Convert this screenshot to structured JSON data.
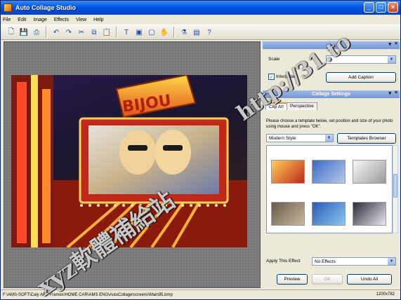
{
  "window": {
    "title": "Auto Collage Studio",
    "controls": {
      "minimize": "_",
      "maximize": "□",
      "close": "×"
    }
  },
  "menu": [
    "File",
    "Edit",
    "Image",
    "Effects",
    "View",
    "Help"
  ],
  "toolbar": {
    "buttons": [
      {
        "name": "new",
        "icon": "new-file-icon",
        "glyph": "🗋"
      },
      {
        "name": "save",
        "icon": "save-icon",
        "glyph": "💾"
      },
      {
        "name": "print",
        "icon": "print-icon",
        "glyph": "⎙"
      },
      {
        "name": "undo",
        "icon": "undo-icon",
        "glyph": "↶"
      },
      {
        "name": "redo",
        "icon": "redo-icon",
        "glyph": "↷"
      },
      {
        "name": "cut",
        "icon": "cut-icon",
        "glyph": "✂"
      },
      {
        "name": "copy",
        "icon": "copy-icon",
        "glyph": "⧉"
      },
      {
        "name": "paste",
        "icon": "paste-icon",
        "glyph": "📋"
      },
      {
        "name": "text",
        "icon": "text-icon",
        "glyph": "T"
      },
      {
        "name": "image",
        "icon": "image-icon",
        "glyph": "▣"
      },
      {
        "name": "frame",
        "icon": "frame-icon",
        "glyph": "▢"
      },
      {
        "name": "hand",
        "icon": "hand-icon",
        "glyph": "✋"
      },
      {
        "name": "effects",
        "icon": "effects-icon",
        "glyph": "⚗"
      },
      {
        "name": "pages",
        "icon": "pages-icon",
        "glyph": "▤"
      },
      {
        "name": "help",
        "icon": "help-icon",
        "glyph": "?"
      }
    ]
  },
  "caption_panel": {
    "scale_label": "Scale",
    "interpolation_label": "Interpolate",
    "interpolation_checked": true,
    "add_caption_label": "Add Caption"
  },
  "collage_settings": {
    "title": "Collage Settings",
    "tabs": [
      "Clip Art",
      "Perspective"
    ],
    "description": "Please choose a template below, set position and size of your photo using mouse and press \"OK\".",
    "style_select": "Modern Style",
    "templates_browser_label": "Templates Browser",
    "apply_effect_label": "Apply This Effect",
    "effect_select": "No Effects",
    "preview_label": "Preview",
    "ok_label": "OK",
    "undo_all_label": "Undo All"
  },
  "canvas": {
    "sign_text": "BIJOU"
  },
  "status": {
    "path": "F:\\AMS-SOFT\\Caly ART Frames\\HOME CAR\\AMS ENG\\AutoCollage\\screens\\Main95.bmp",
    "dimensions": "1200x782"
  },
  "watermarks": {
    "url": "http://31.to",
    "chinese": "xyz軟體補給站"
  },
  "colors": {
    "title_bar": "#0054e3",
    "workspace": "#787878",
    "panel": "#ece9d8"
  }
}
